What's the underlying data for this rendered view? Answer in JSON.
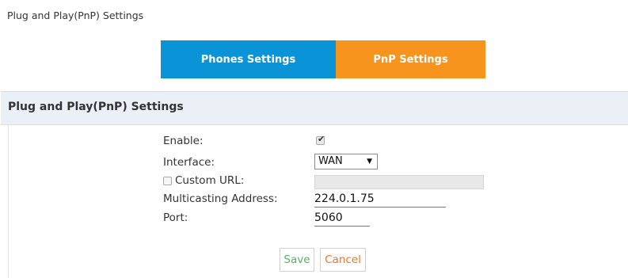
{
  "page": {
    "title": "Plug and Play(PnP) Settings"
  },
  "tabs": [
    {
      "label": "Phones Settings",
      "active": false,
      "color": "#0b93d8"
    },
    {
      "label": "PnP Settings",
      "active": true,
      "color": "#f7941d"
    }
  ],
  "panel": {
    "title": "Plug and Play(PnP) Settings",
    "enable": {
      "label": "Enable:",
      "checked": true
    },
    "interface": {
      "label": "Interface:",
      "value": "WAN"
    },
    "custom_url": {
      "label": "Custom URL:",
      "checked": false,
      "value": ""
    },
    "multicasting_address": {
      "label": "Multicasting Address:",
      "value": "224.0.1.75"
    },
    "port": {
      "label": "Port:",
      "value": "5060"
    },
    "buttons": {
      "save": "Save",
      "cancel": "Cancel"
    }
  },
  "colors": {
    "tab_phones": "#0b93d8",
    "tab_pnp": "#f7941d",
    "save_text": "#57b35a",
    "cancel_text": "#f5731f",
    "header_bg": "#eaf0f5"
  }
}
